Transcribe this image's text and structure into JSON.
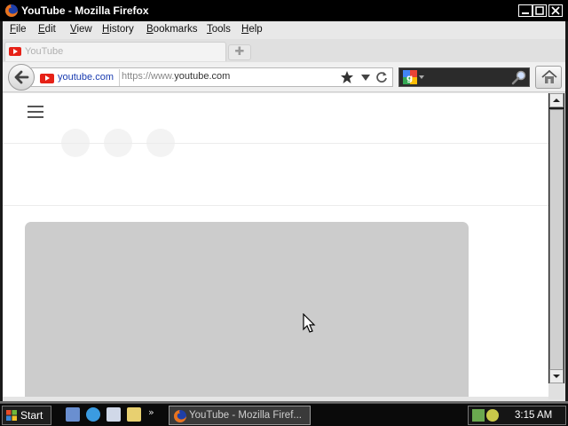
{
  "window": {
    "title": "YouTube - Mozilla Firefox"
  },
  "menubar": {
    "items": [
      "File",
      "Edit",
      "View",
      "History",
      "Bookmarks",
      "Tools",
      "Help"
    ]
  },
  "tabs": [
    {
      "label": "YouTube",
      "active": true
    }
  ],
  "navbar": {
    "identity_domain": "youtube.com",
    "url_prefix": "https://www.",
    "url_host": "youtube.com",
    "search_engine_icon": "google-icon",
    "search_placeholder": ""
  },
  "content": {
    "background": "#ffffff",
    "placeholder_color": "#cccccc"
  },
  "taskbar": {
    "start_label": "Start",
    "more_label": "»",
    "tasks": [
      {
        "label": "YouTube - Mozilla Firef...",
        "icon": "firefox-icon"
      }
    ],
    "clock": "3:15 AM"
  },
  "colors": {
    "brand_youtube": "#e62117",
    "titlebar": "#000000",
    "link": "#1a3cb0"
  }
}
